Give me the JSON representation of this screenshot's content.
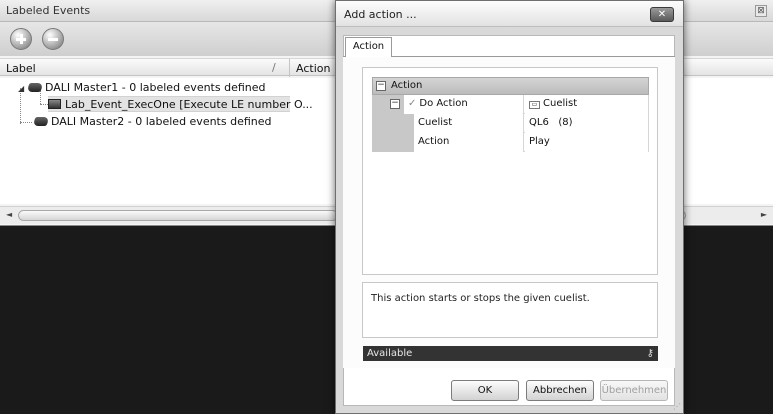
{
  "background": {
    "title": "Labeled Events",
    "close_glyph": "⊠",
    "toolbar": {
      "add_icon": "plus-circle-icon",
      "remove_icon": "minus-circle-icon"
    },
    "columns": {
      "label": "Label",
      "sort_glyph": "/",
      "action": "Action"
    },
    "tree": [
      {
        "label": "DALI Master1 - 0 labeled events defined"
      },
      {
        "label": "Lab_Event_ExecOne [Execute LE number O..."
      },
      {
        "label": "DALI Master2 - 0 labeled events defined"
      }
    ],
    "scroll": {
      "left": "◄",
      "right": "►"
    }
  },
  "dialog": {
    "title": "Add action ...",
    "close_glyph": "✕",
    "tab_label": "Action",
    "property_grid": {
      "category": "Action",
      "subcategory": "Do Action",
      "subcategory_value": "Cuelist",
      "rows": [
        {
          "name": "Cuelist",
          "value": "QL6   (8)"
        },
        {
          "name": "Action",
          "value": "Play"
        }
      ]
    },
    "description": "This action starts or stops the given cuelist.",
    "status": "Available",
    "status_icon": "key-icon",
    "buttons": {
      "ok": "OK",
      "cancel": "Abbrechen",
      "apply": "Übernehmen"
    }
  }
}
